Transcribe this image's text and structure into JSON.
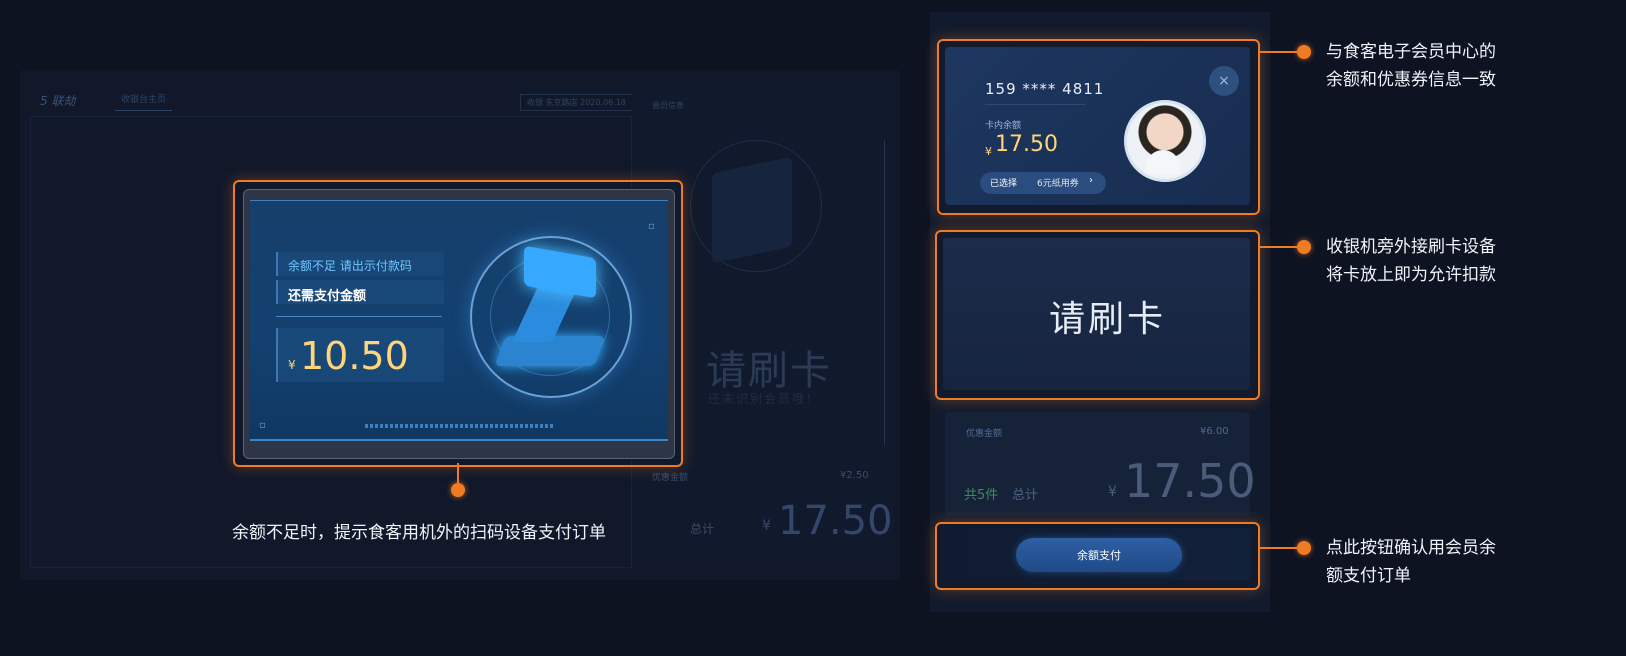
{
  "background_app": {
    "logo": "5 联劫",
    "tab": "收银台主页",
    "info": "收银  东京路店  2020.06.18",
    "right_label": "会员信息",
    "swipe_title": "请刷卡",
    "swipe_subtitle": "还未识别会员哦！",
    "discount_label": "优惠金额",
    "discount_value": "¥2.50",
    "total_label": "总计",
    "total_currency": "¥",
    "total_value": "17.50"
  },
  "main_card": {
    "warning": "余额不足 请出示付款码",
    "need_pay_label": "还需支付金额",
    "currency": "¥",
    "amount": "10.50",
    "corner_icon": "▫",
    "corner_icon2": "▫",
    "caption": "余额不足时，提示食客用机外的扫码设备支付订单"
  },
  "member_card": {
    "phone": "159 **** 4811",
    "balance_label": "卡内余额",
    "currency": "¥",
    "balance": "17.50",
    "coupon_selected": "已选择",
    "coupon_name": "6元纸用券",
    "coupon_chevron": "›",
    "close_icon": "×"
  },
  "swipe_card": {
    "text": "请刷卡"
  },
  "summary": {
    "discount_label": "优惠金额",
    "discount_value": "¥6.00",
    "items_count": "共5件",
    "total_label": "总计",
    "currency": "¥",
    "total": "17.50"
  },
  "pay": {
    "button_label": "余额支付"
  },
  "annotations": {
    "member": [
      "与食客电子会员中心的",
      "余额和优惠券信息一致"
    ],
    "swipe": [
      "收银机旁外接刷卡设备",
      "将卡放上即为允许扣款"
    ],
    "pay": [
      "点此按钮确认用会员余",
      "额支付订单"
    ]
  },
  "colors": {
    "accent": "#f07b22",
    "background": "#0e1322",
    "amount": "#ffd47a"
  }
}
